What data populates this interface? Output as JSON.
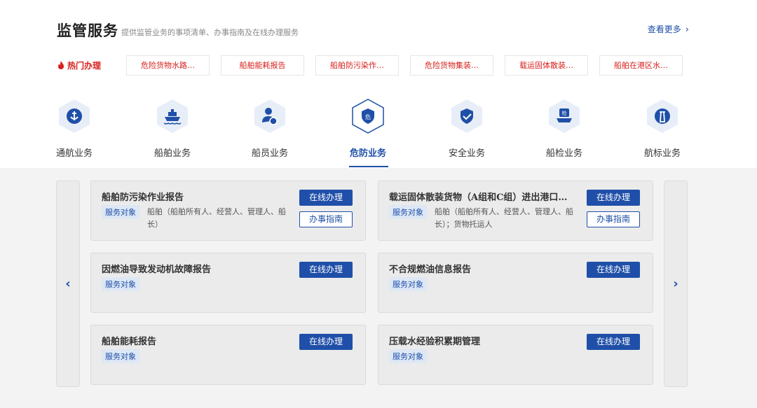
{
  "header": {
    "title": "监管服务",
    "subtitle": "提供监管业务的事项清单、办事指南及在线办理服务",
    "more_label": "查看更多",
    "more_chevron": "›"
  },
  "hot": {
    "label": "热门办理",
    "tags": [
      "危险货物水路…",
      "船舶能耗报告",
      "船舶防污染作…",
      "危险货物集装…",
      "载运固体散装…",
      "船舶在港区水…"
    ]
  },
  "categories": [
    {
      "label": "通航业务",
      "icon": "anchor-icon",
      "active": false
    },
    {
      "label": "船舶业务",
      "icon": "ship-icon",
      "active": false
    },
    {
      "label": "船员业务",
      "icon": "crew-icon",
      "active": false
    },
    {
      "label": "危防业务",
      "icon": "hazard-icon",
      "active": true
    },
    {
      "label": "安全业务",
      "icon": "shield-check-icon",
      "active": false
    },
    {
      "label": "船检业务",
      "icon": "inspection-icon",
      "active": false
    },
    {
      "label": "航标业务",
      "icon": "lighthouse-icon",
      "active": false
    }
  ],
  "pager": {
    "prev": "‹",
    "next": "›"
  },
  "services": [
    {
      "title": "船舶防污染作业报告",
      "tag": "服务对象",
      "audience": "船舶（船舶所有人、经营人、管理人、船长）",
      "online": "在线办理",
      "guide": "办事指南"
    },
    {
      "title": "载运固体散装货物（A组和C组）进出港口…",
      "tag": "服务对象",
      "audience": "船舶（船舶所有人、经营人、管理人、船长）；货物托运人",
      "online": "在线办理",
      "guide": "办事指南"
    },
    {
      "title": "因燃油导致发动机故障报告",
      "tag": "服务对象",
      "audience": "",
      "online": "在线办理"
    },
    {
      "title": "不合规燃油信息报告",
      "tag": "服务对象",
      "audience": "",
      "online": "在线办理"
    },
    {
      "title": "船舶能耗报告",
      "tag": "服务对象",
      "audience": "",
      "online": "在线办理"
    },
    {
      "title": "压载水经验积累期管理",
      "tag": "服务对象",
      "audience": "",
      "online": "在线办理"
    }
  ],
  "colors": {
    "primary": "#1f4fa8",
    "hot": "#d6201c",
    "hex_bg": "#e8eef8"
  }
}
